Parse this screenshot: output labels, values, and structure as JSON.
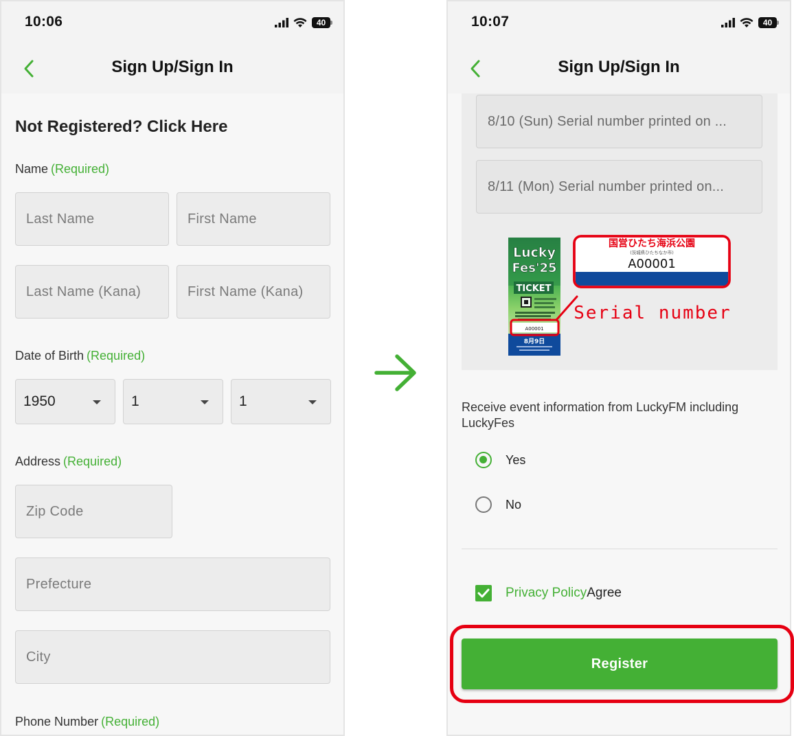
{
  "colors": {
    "accent": "#44b035",
    "highlight": "#e60012",
    "field_bg": "#ececec"
  },
  "left_screen": {
    "status": {
      "time": "10:06",
      "battery": "40"
    },
    "nav": {
      "title": "Sign Up/Sign In",
      "back_icon": "chevron-left-icon"
    },
    "heading": "Not Registered? Click Here",
    "name": {
      "label": "Name",
      "required": "(Required)",
      "last_name_placeholder": "Last Name",
      "first_name_placeholder": "First Name",
      "last_kana_placeholder": "Last Name (Kana)",
      "first_kana_placeholder": "First Name (Kana)"
    },
    "dob": {
      "label": "Date of Birth",
      "required": "(Required)",
      "year": "1950",
      "month": "1",
      "day": "1"
    },
    "address": {
      "label": "Address",
      "required": "(Required)",
      "zip_placeholder": "Zip Code",
      "prefecture_placeholder": "Prefecture",
      "city_placeholder": "City"
    },
    "phone": {
      "label": "Phone Number",
      "required": "(Required)"
    }
  },
  "transition_icon": "arrow-right-icon",
  "right_screen": {
    "status": {
      "time": "10:07",
      "battery": "40"
    },
    "nav": {
      "title": "Sign Up/Sign In",
      "back_icon": "chevron-left-icon"
    },
    "serial_fields": [
      {
        "placeholder": "8/10 (Sun) Serial number printed on ..."
      },
      {
        "placeholder": "8/11 (Mon) Serial number printed on..."
      }
    ],
    "ticket_image": {
      "ticket_logo_line1": "Lucky",
      "ticket_logo_line2": "Fes'25",
      "ticket_word": "TICKET",
      "ticket_date": "8月9日",
      "ticket_serial": "A00001",
      "callout_venue": "国営ひたち海浜公園",
      "callout_venue_sub": "(茨城県ひたちなか市)",
      "callout_serial": "A00001",
      "callout_caption": "Serial number"
    },
    "promo": {
      "text": "Receive event information from LuckyFM including LuckyFes",
      "yes_label": "Yes",
      "no_label": "No",
      "selected": "Yes"
    },
    "agree": {
      "checked": true,
      "link_text": "Privacy Policy",
      "suffix": "Agree"
    },
    "register_label": "Register"
  }
}
